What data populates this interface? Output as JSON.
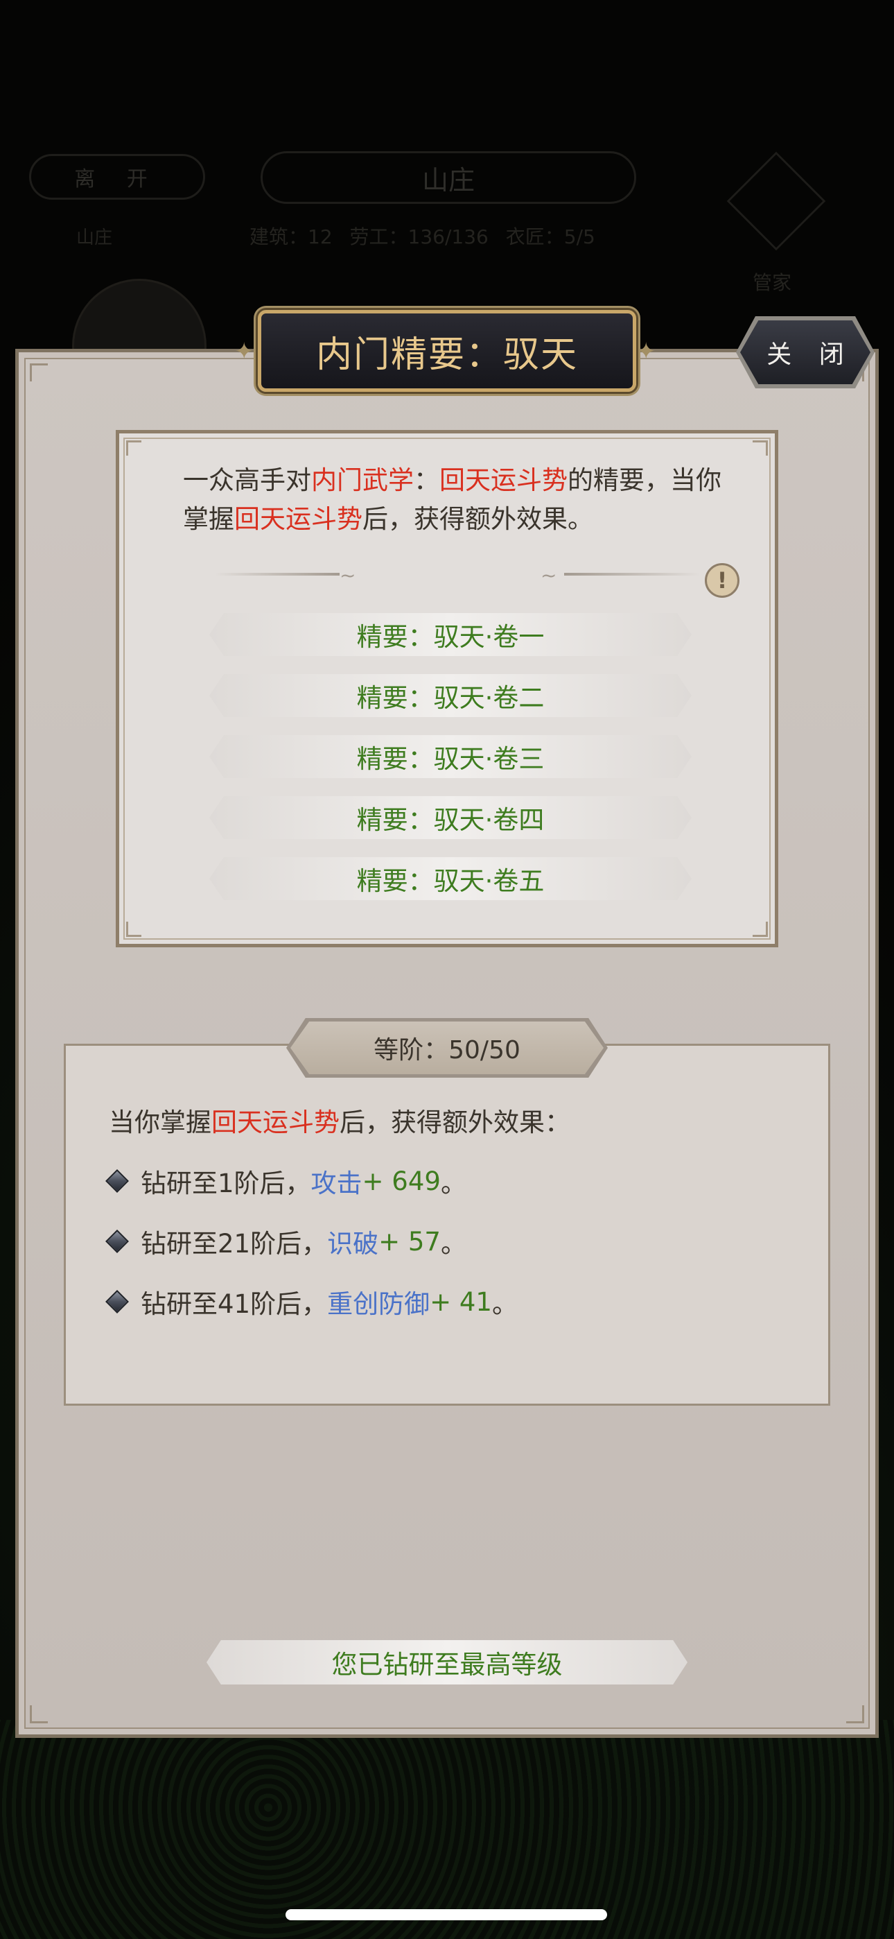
{
  "background": {
    "leave_button": "离 开",
    "page_title": "山庄",
    "stats": [
      "建筑：12",
      "劳工：136/136",
      "衣匠：5/5"
    ],
    "left_label": "山庄",
    "steward_label": "管家"
  },
  "modal": {
    "title": "内门精要：驭天",
    "close_label": "关 闭",
    "intro": {
      "part1": "一众高手对",
      "highlight1": "内门武学",
      "part2": "：",
      "highlight2": "回天运斗势",
      "part3": "的精要，当你掌握",
      "highlight3": "回天运斗势",
      "part4": "后，获得额外效果。"
    },
    "volumes": [
      "精要：驭天·卷一",
      "精要：驭天·卷二",
      "精要：驭天·卷三",
      "精要：驭天·卷四",
      "精要：驭天·卷五"
    ],
    "rank": {
      "label": "等阶：50/50"
    },
    "effects_intro": {
      "part1": "当你掌握",
      "highlight": "回天运斗势",
      "part2": "后，获得额外效果："
    },
    "effects": [
      {
        "prefix": "钻研至1阶后，",
        "stat": "攻击",
        "value": " + 649",
        "suffix": "。"
      },
      {
        "prefix": "钻研至21阶后，",
        "stat": "识破",
        "value": " + 57",
        "suffix": "。"
      },
      {
        "prefix": "钻研至41阶后，",
        "stat": "重创防御",
        "value": " + 41",
        "suffix": "。"
      }
    ],
    "max_level_text": "您已钻研至最高等级"
  },
  "colors": {
    "highlight_red": "#d9301f",
    "stat_blue": "#4a72c8",
    "value_green": "#3e7c1f",
    "title_gold": "#e8c88c"
  }
}
